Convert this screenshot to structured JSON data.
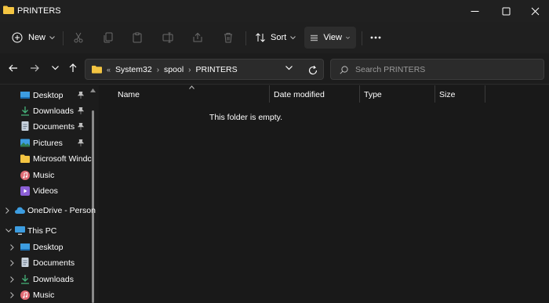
{
  "window": {
    "title": "PRINTERS",
    "icon": "folder-icon"
  },
  "commandbar": {
    "new_label": "New",
    "sort_label": "Sort",
    "view_label": "View"
  },
  "address": {
    "overflow": "«",
    "crumbs": [
      "System32",
      "spool",
      "PRINTERS"
    ]
  },
  "search": {
    "placeholder": "Search PRINTERS"
  },
  "sidebar": {
    "quick_access": [
      {
        "label": "Desktop",
        "icon": "desktop-icon",
        "pinned": true
      },
      {
        "label": "Downloads",
        "icon": "downloads-icon",
        "pinned": true
      },
      {
        "label": "Documents",
        "icon": "documents-icon",
        "pinned": true
      },
      {
        "label": "Pictures",
        "icon": "pictures-icon",
        "pinned": true
      },
      {
        "label": "Microsoft Windc",
        "icon": "folder-icon",
        "pinned": false
      },
      {
        "label": "Music",
        "icon": "music-icon",
        "pinned": false
      },
      {
        "label": "Videos",
        "icon": "videos-icon",
        "pinned": false
      }
    ],
    "onedrive": {
      "label": "OneDrive - Person",
      "icon": "onedrive-icon"
    },
    "this_pc": {
      "label": "This PC",
      "icon": "pc-icon"
    },
    "pc_children": [
      {
        "label": "Desktop",
        "icon": "desktop-icon"
      },
      {
        "label": "Documents",
        "icon": "documents-icon"
      },
      {
        "label": "Downloads",
        "icon": "downloads-icon"
      },
      {
        "label": "Music",
        "icon": "music-icon"
      }
    ]
  },
  "content": {
    "columns": [
      "Name",
      "Date modified",
      "Type",
      "Size"
    ],
    "empty_message": "This folder is empty."
  },
  "colors": {
    "background": "#191919",
    "folder": "#f4c542",
    "accent": "#4aa3df"
  }
}
